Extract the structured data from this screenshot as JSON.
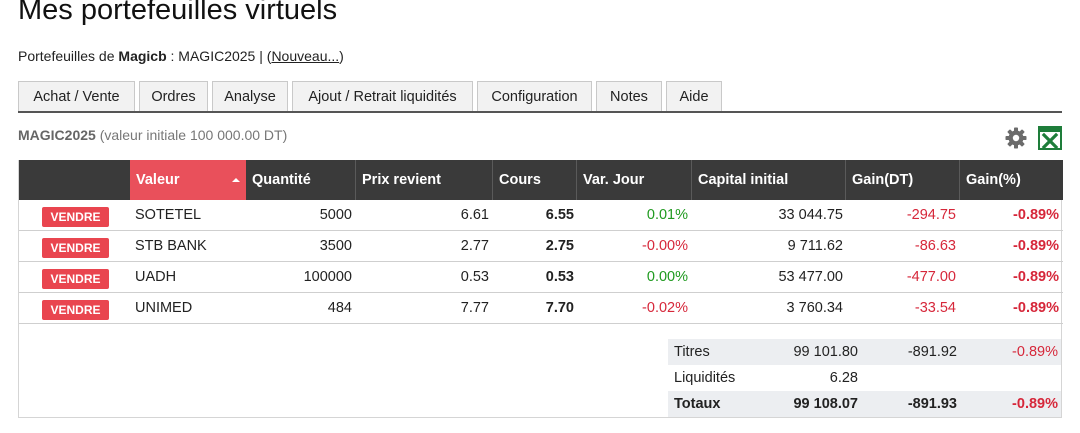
{
  "page": {
    "title": "Mes portefeuilles virtuels"
  },
  "subline": {
    "prefix": "Portefeuilles de",
    "owner": "Magicb",
    "portfolio": ": MAGIC2025 |",
    "paren_open": "(",
    "new_link": "Nouveau...",
    "paren_close": ")"
  },
  "tabs": [
    {
      "label": "Achat / Vente"
    },
    {
      "label": "Ordres"
    },
    {
      "label": "Analyse"
    },
    {
      "label": "Ajout / Retrait liquidités"
    },
    {
      "label": "Configuration"
    },
    {
      "label": "Notes"
    },
    {
      "label": "Aide"
    }
  ],
  "portfolio_info": {
    "name": "MAGIC2025",
    "initial_value": "(valeur initiale 100 000.00 DT)"
  },
  "icons": {
    "settings": "gear-icon",
    "export": "excel-icon",
    "export_color": "#1e7d3a"
  },
  "colors": {
    "header_bg": "#3a3a3a",
    "active_header": "#e9505b",
    "sell_button": "#e9454f",
    "positive": "#1f9a1f",
    "negative": "#d6273a"
  },
  "table": {
    "columns": {
      "valeur": "Valeur",
      "quantite": "Quantité",
      "prix_revient": "Prix revient",
      "cours": "Cours",
      "var_jour": "Var. Jour",
      "capital_initial": "Capital initial",
      "gain_dt": "Gain(DT)",
      "gain_pct": "Gain(%)"
    },
    "sell_label": "VENDRE",
    "rows": [
      {
        "valeur": "SOTETEL",
        "quantite": "5000",
        "prix_revient": "6.61",
        "cours": "6.55",
        "var_jour": "0.01%",
        "capital_initial": "33 044.75",
        "gain_dt": "-294.75",
        "gain_pct": "-0.89%"
      },
      {
        "valeur": "STB BANK",
        "quantite": "3500",
        "prix_revient": "2.77",
        "cours": "2.75",
        "var_jour": "-0.00%",
        "capital_initial": "9 711.62",
        "gain_dt": "-86.63",
        "gain_pct": "-0.89%"
      },
      {
        "valeur": "UADH",
        "quantite": "100000",
        "prix_revient": "0.53",
        "cours": "0.53",
        "var_jour": "0.00%",
        "capital_initial": "53 477.00",
        "gain_dt": "-477.00",
        "gain_pct": "-0.89%"
      },
      {
        "valeur": "UNIMED",
        "quantite": "484",
        "prix_revient": "7.77",
        "cours": "7.70",
        "var_jour": "-0.02%",
        "capital_initial": "3 760.34",
        "gain_dt": "-33.54",
        "gain_pct": "-0.89%"
      }
    ]
  },
  "summary": {
    "titres": {
      "label": "Titres",
      "value": "99 101.80",
      "gain": "-891.92",
      "pct": "-0.89%"
    },
    "liquidites": {
      "label": "Liquidités",
      "value": "6.28"
    },
    "totaux": {
      "label": "Totaux",
      "value": "99 108.07",
      "gain": "-891.93",
      "pct": "-0.89%"
    }
  }
}
